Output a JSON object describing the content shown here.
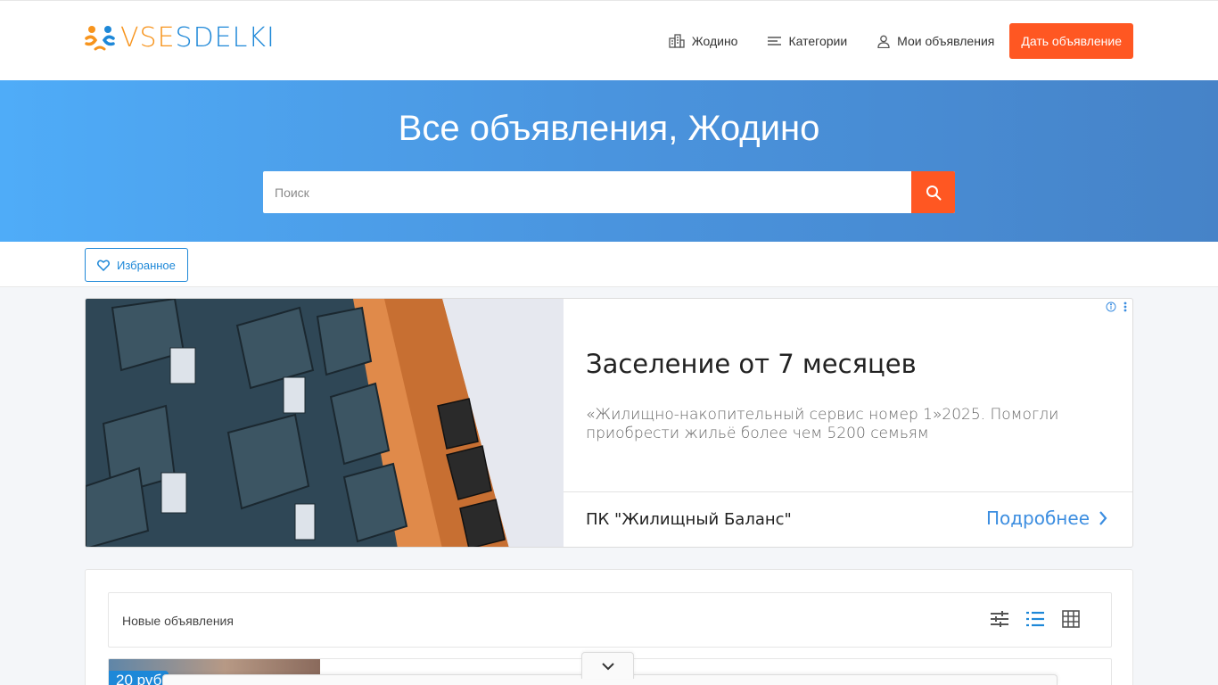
{
  "header": {
    "logo": {
      "part1": "VSE",
      "part2": "SDELKI"
    },
    "nav": {
      "city": "Жодино",
      "categories": "Категории",
      "my_ads": "Мои объявления",
      "post_ad": "Дать объявление"
    }
  },
  "hero": {
    "title": "Все объявления, Жодино",
    "search_placeholder": "Поиск"
  },
  "favorites": {
    "label": "Избранное"
  },
  "ad_banner": {
    "title": "Заселение от 7 месяцев",
    "description": "«Жилищно-накопительный сервис номер 1»2025. Помогли приобрести жильё более чем 5200 семьям",
    "company": "ПК \"Жилищный Баланс\"",
    "more_label": "Подробнее"
  },
  "listing": {
    "title": "Новые объявления",
    "first_card": {
      "price": "20 руб"
    }
  },
  "colors": {
    "accent_orange": "#ff5722",
    "brand_blue": "#1e88d8",
    "logo_orange": "#f7941d"
  },
  "icons": [
    "city-icon",
    "menu-icon",
    "user-icon",
    "search-icon",
    "heart-icon",
    "chevron-right-icon",
    "info-icon",
    "more-icon",
    "filter-icon",
    "list-view-icon",
    "grid-view-icon",
    "chevron-down-icon"
  ]
}
